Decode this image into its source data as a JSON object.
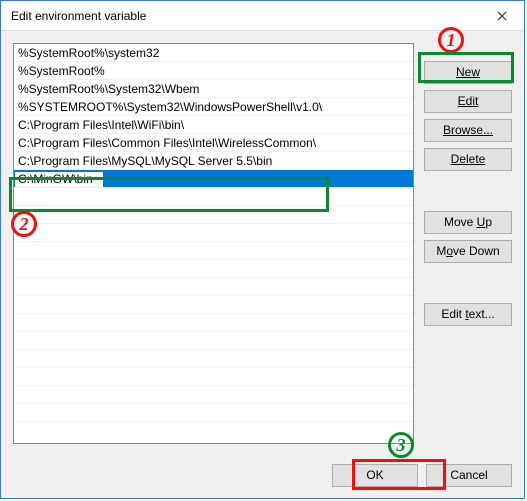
{
  "title": "Edit environment variable",
  "list": {
    "items": [
      "%SystemRoot%\\system32",
      "%SystemRoot%",
      "%SystemRoot%\\System32\\Wbem",
      "%SYSTEMROOT%\\System32\\WindowsPowerShell\\v1.0\\",
      "C:\\Program Files\\Intel\\WiFi\\bin\\",
      "C:\\Program Files\\Common Files\\Intel\\WirelessCommon\\",
      "C:\\Program Files\\MySQL\\MySQL Server 5.5\\bin"
    ],
    "editing_value": "C:\\MinGW\\bin"
  },
  "buttons": {
    "new": "New",
    "edit": "Edit",
    "browse": "Browse...",
    "delete": "Delete",
    "moveup": "Move Up",
    "movedown": "Move Down",
    "edittext": "Edit text...",
    "ok": "OK",
    "cancel": "Cancel"
  },
  "annotations": {
    "n1": "1",
    "n2": "2",
    "n3": "3"
  }
}
